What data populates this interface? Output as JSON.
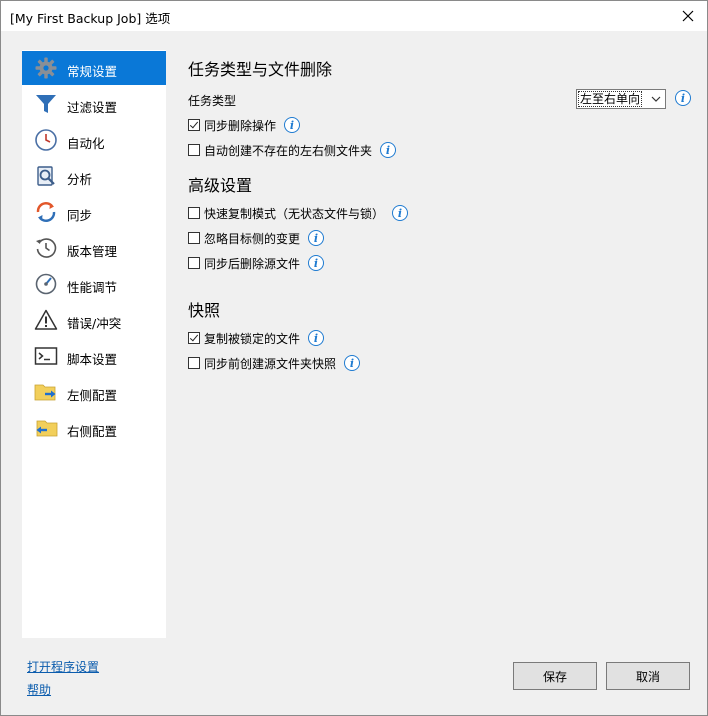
{
  "window": {
    "title": "[My First Backup Job] 选项"
  },
  "sidebar": {
    "items": [
      {
        "label": "常规设置",
        "icon": "gear-icon",
        "selected": true
      },
      {
        "label": "过滤设置",
        "icon": "filter-icon"
      },
      {
        "label": "自动化",
        "icon": "clock-icon"
      },
      {
        "label": "分析",
        "icon": "analysis-icon"
      },
      {
        "label": "同步",
        "icon": "sync-icon"
      },
      {
        "label": "版本管理",
        "icon": "history-icon"
      },
      {
        "label": "性能调节",
        "icon": "gauge-icon"
      },
      {
        "label": "错误/冲突",
        "icon": "warning-icon"
      },
      {
        "label": "脚本设置",
        "icon": "terminal-icon"
      },
      {
        "label": "左侧配置",
        "icon": "folder-right-arrow-icon"
      },
      {
        "label": "右侧配置",
        "icon": "folder-left-arrow-icon"
      }
    ]
  },
  "main": {
    "section1_title": "任务类型与文件删除",
    "task_type_label": "任务类型",
    "task_type_value": "左至右单向",
    "sync_delete": {
      "label": "同步删除操作",
      "checked": true
    },
    "auto_create": {
      "label": "自动创建不存在的左右侧文件夹",
      "checked": false
    },
    "section2_title": "高级设置",
    "fast_copy": {
      "label": "快速复制模式（无状态文件与锁）",
      "checked": false
    },
    "ignore_target_changes": {
      "label": "忽略目标侧的变更",
      "checked": false
    },
    "delete_source": {
      "label": "同步后删除源文件",
      "checked": false
    },
    "section3_title": "快照",
    "copy_locked": {
      "label": "复制被锁定的文件",
      "checked": true
    },
    "snapshot_before": {
      "label": "同步前创建源文件夹快照",
      "checked": false
    }
  },
  "footer": {
    "open_program_settings": "打开程序设置",
    "help": "帮助",
    "save": "保存",
    "cancel": "取消"
  },
  "colors": {
    "accent": "#0a78d7",
    "info": "#1f7bd1",
    "link": "#0b5cad"
  }
}
